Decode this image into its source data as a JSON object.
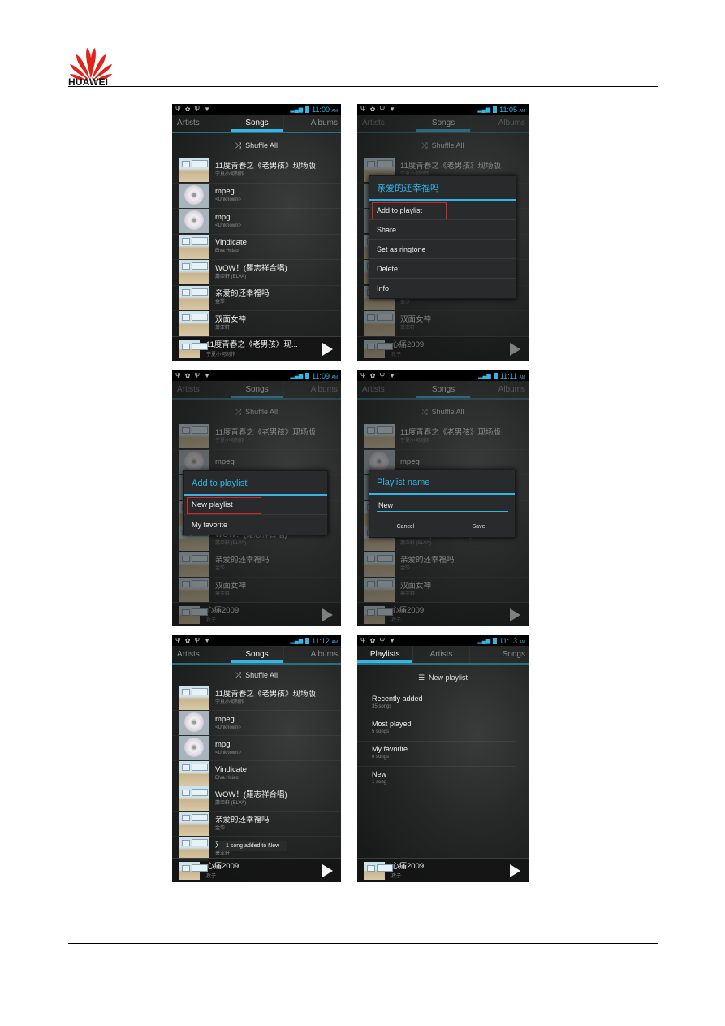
{
  "brand": {
    "name": "HUAWEI",
    "logo_color": "#e2231a"
  },
  "status": {
    "times": [
      "11:00",
      "11:05",
      "11:09",
      "11:11",
      "11:12",
      "11:13"
    ],
    "ampm": "AM"
  },
  "music": {
    "tabs_songs": [
      "Artists",
      "Songs",
      "Albums"
    ],
    "tabs_playlists": [
      "Playlists",
      "Artists",
      "Songs"
    ],
    "shuffle_label": "Shuffle All",
    "songs": [
      {
        "title": "11度青春之《老男孩》现场版",
        "artist": "宁夏小何制作",
        "art": "photo"
      },
      {
        "title": "mpeg",
        "artist": "<Unknown>",
        "art": "cd"
      },
      {
        "title": "mpg",
        "artist": "<Unknown>",
        "art": "cd"
      },
      {
        "title": "Vindicate",
        "artist": "Elva Hsiao",
        "art": "photo"
      },
      {
        "title": "WOW！(羅志祥合唱)",
        "artist": "蕭亞軒 (ELVA)",
        "art": "photo"
      },
      {
        "title": "亲爱的还幸福吗",
        "artist": "金莎",
        "art": "photo"
      },
      {
        "title": "双面女神",
        "artist": "萧亚轩",
        "art": "photo"
      }
    ],
    "now_playing_1": {
      "title": "11度青春之《老男孩》现...",
      "artist": "宁夏小何制作"
    },
    "now_playing_2": {
      "title": "心痛2009",
      "artist": "孜子"
    }
  },
  "context_menu": {
    "title": "亲爱的还幸福吗",
    "items": [
      "Add to playlist",
      "Share",
      "Set as ringtone",
      "Delete",
      "Info"
    ]
  },
  "add_to_playlist": {
    "title": "Add to playlist",
    "items": [
      "New playlist",
      "My favorite"
    ]
  },
  "playlist_name": {
    "title": "Playlist name",
    "value": "New",
    "cancel": "Cancel",
    "save": "Save"
  },
  "toast": "1 song added to New",
  "playlists": {
    "new_label": "New playlist",
    "items": [
      {
        "name": "Recently added",
        "count": "35 songs"
      },
      {
        "name": "Most played",
        "count": "5 songs"
      },
      {
        "name": "My favorite",
        "count": "0 songs"
      },
      {
        "name": "New",
        "count": "1 song"
      }
    ]
  }
}
